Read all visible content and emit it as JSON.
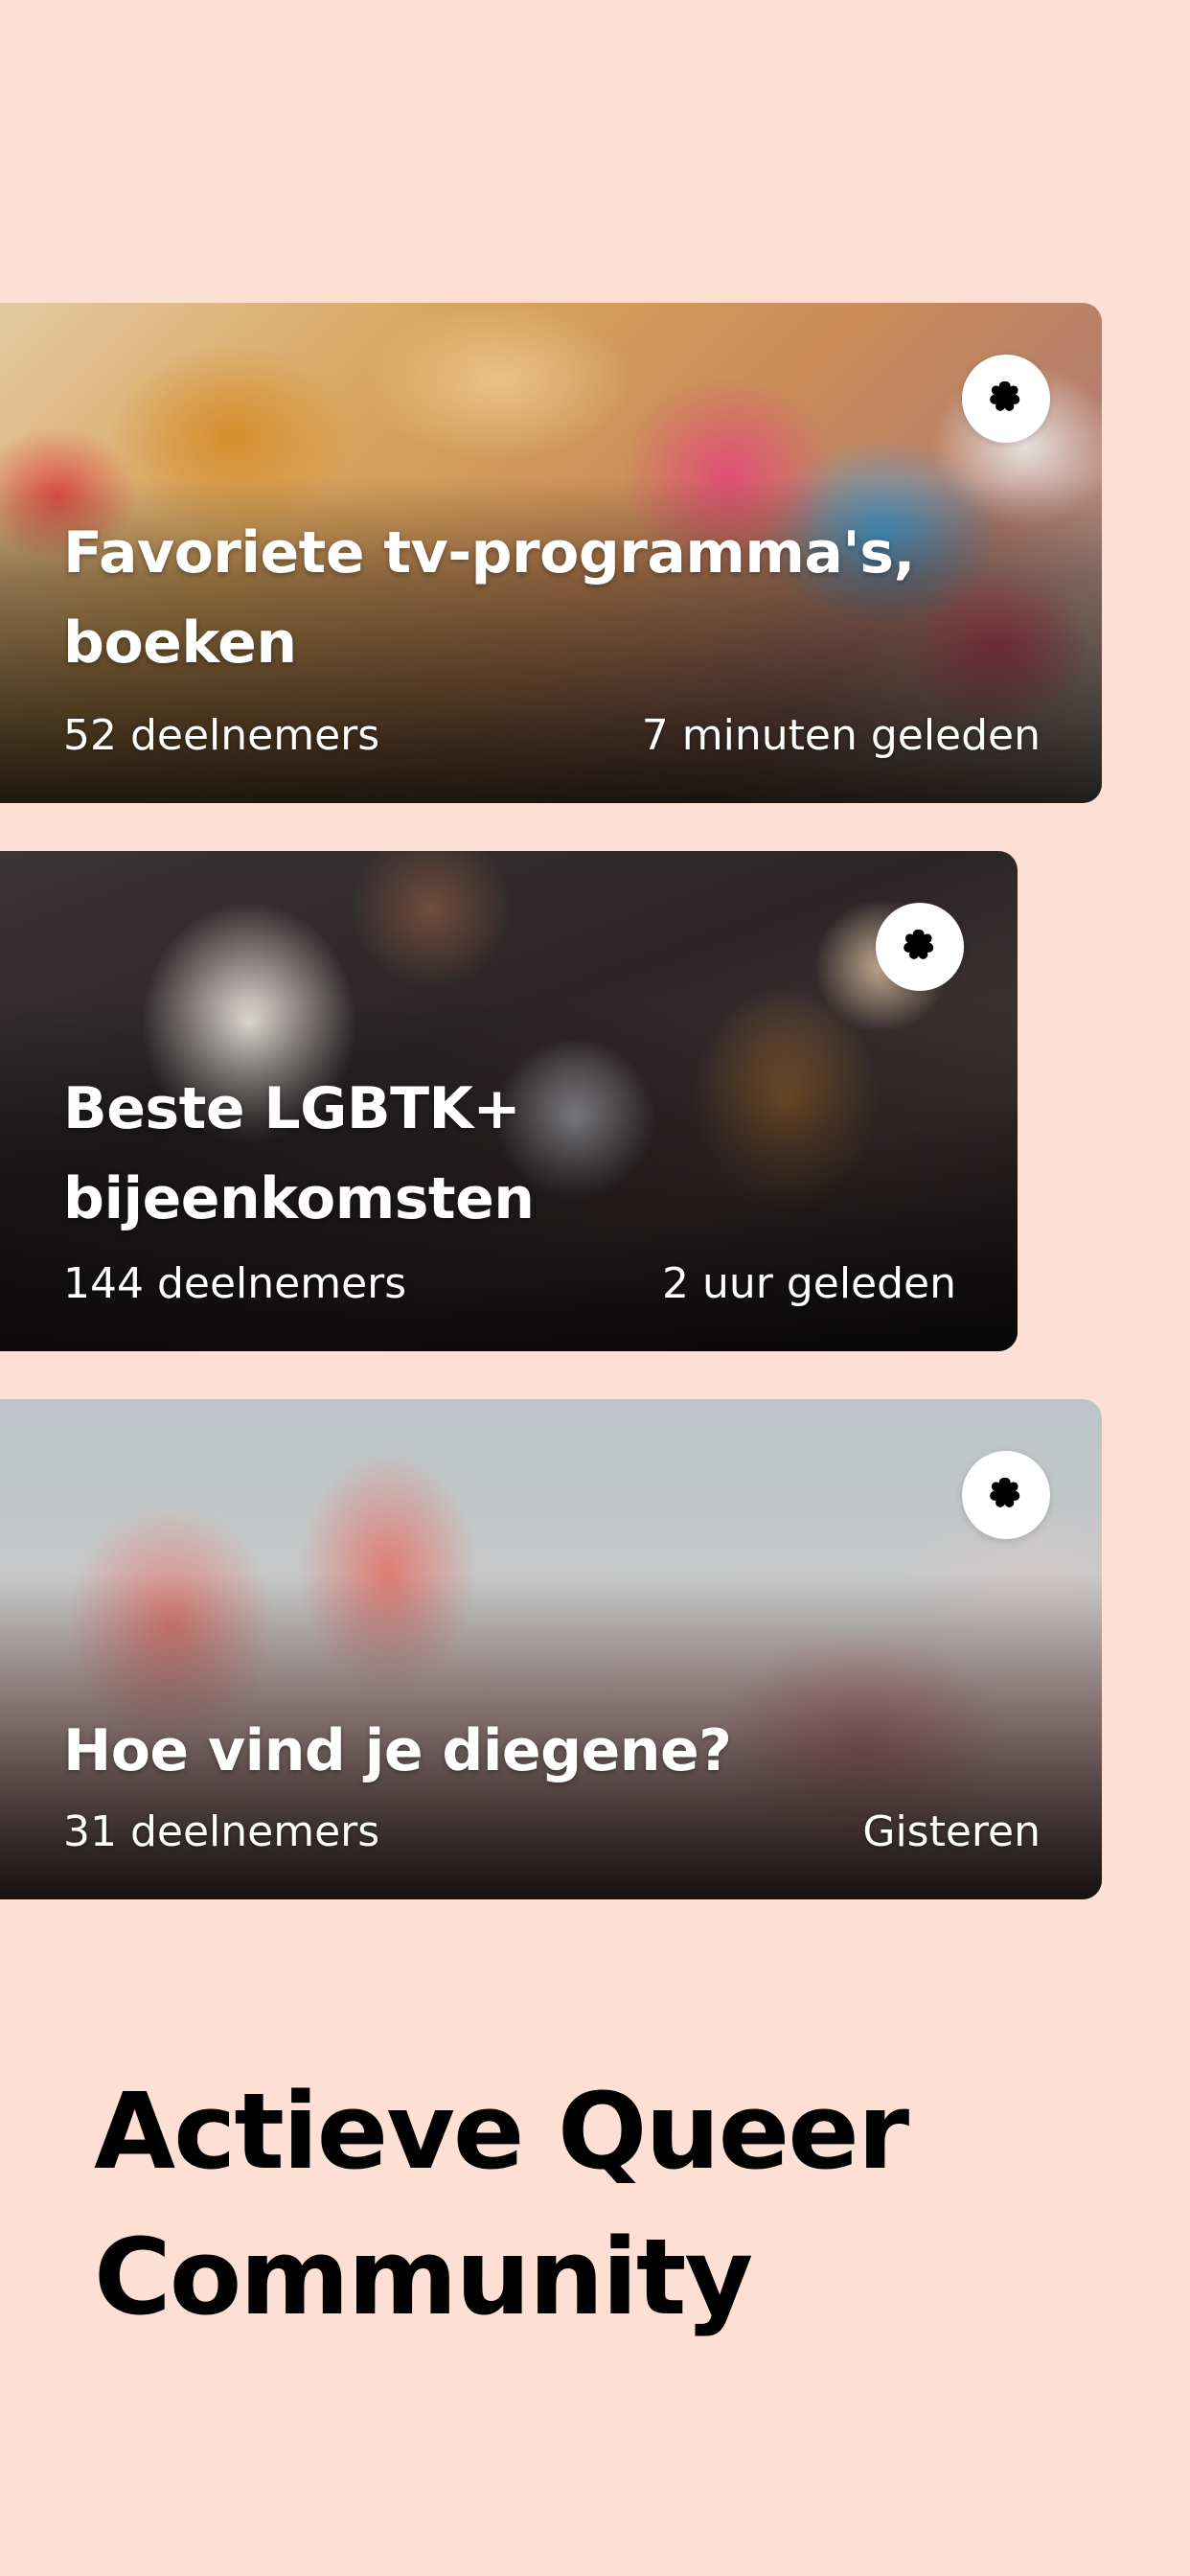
{
  "colors": {
    "background": "#fde0d3",
    "card_text": "#ffffff",
    "headline_text": "#000000",
    "fav_button_bg": "#ffffff",
    "fav_icon": "#000000"
  },
  "cards": [
    {
      "title": "Favoriete tv-programma's, boeken",
      "participants": "52 deelnemers",
      "time": "7 minuten geleden",
      "icon": "flower-icon"
    },
    {
      "title": "Beste LGBTK+ bijeenkomsten",
      "participants": "144 deelnemers",
      "time": "2 uur geleden",
      "icon": "flower-icon"
    },
    {
      "title": "Hoe vind je diegene?",
      "participants": "31 deelnemers",
      "time": "Gisteren",
      "icon": "flower-icon"
    }
  ],
  "headline": {
    "line1": "Actieve Queer",
    "line2": "Community"
  }
}
